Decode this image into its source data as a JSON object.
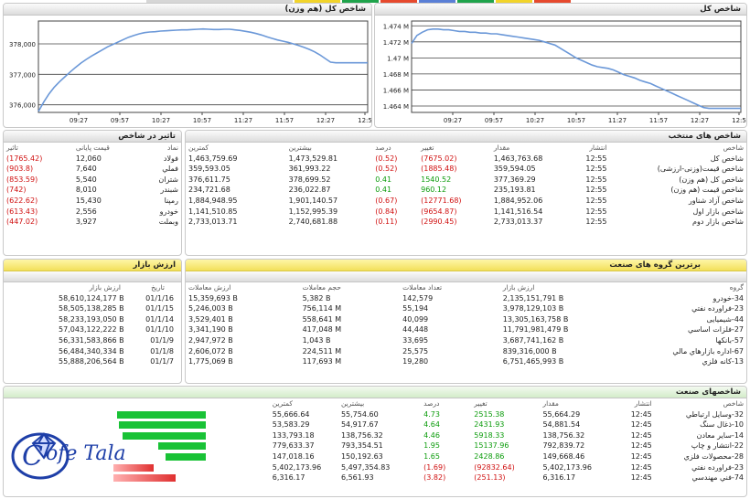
{
  "top_strip_colors": [
    "#d6d6d6",
    "#f2d42a",
    "#1fa34b",
    "#e6492d",
    "#5a7fd6",
    "#1fa34b",
    "#f2d42a",
    "#e6492d"
  ],
  "chart_left": {
    "title": "شاخص کل (هم وزن)",
    "chart_data": {
      "type": "line",
      "title": "شاخص کل (هم وزن)",
      "x_ticks": [
        "09:27",
        "09:57",
        "10:27",
        "10:57",
        "11:27",
        "11:57",
        "12:27",
        "12:5"
      ],
      "y_ticks": [
        "376,000",
        "377,000",
        "378,000"
      ],
      "ylim": [
        375750,
        378750
      ],
      "x": [
        0,
        3,
        6,
        9,
        12,
        15,
        18,
        21,
        24,
        27,
        30,
        33,
        36,
        39,
        42,
        45,
        48,
        51,
        54,
        57,
        60,
        63,
        66,
        69,
        72,
        75,
        78,
        81,
        84,
        87,
        90,
        93,
        96,
        99,
        102,
        105,
        108,
        111,
        114,
        117,
        120,
        123,
        126,
        129,
        132,
        135,
        138,
        141,
        144,
        147,
        150,
        153,
        156,
        159,
        162,
        165,
        168,
        171,
        174,
        177,
        180,
        183,
        186
      ],
      "y": [
        375780,
        376090,
        376360,
        376580,
        376760,
        376920,
        377080,
        377230,
        377370,
        377490,
        377600,
        377700,
        377800,
        377900,
        377980,
        378060,
        378140,
        378220,
        378280,
        378330,
        378370,
        378390,
        378400,
        378420,
        378430,
        378440,
        378450,
        378460,
        378460,
        378470,
        378480,
        378490,
        378480,
        378470,
        378470,
        378480,
        378480,
        378460,
        378440,
        378410,
        378380,
        378340,
        378290,
        378230,
        378180,
        378130,
        378090,
        378050,
        378000,
        377950,
        377890,
        377820,
        377740,
        377640,
        377520,
        377400,
        377380,
        377380,
        377380,
        377380,
        377380,
        377380,
        377380
      ]
    }
  },
  "chart_right": {
    "title": "شاخص کل",
    "chart_data": {
      "type": "line",
      "title": "شاخص کل",
      "x_ticks": [
        "09:27",
        "09:57",
        "10:27",
        "10:57",
        "11:27",
        "11:57",
        "12:27",
        "12:5"
      ],
      "y_ticks": [
        "1.464 M",
        "1.466 M",
        "1.468 M",
        "1.47 M",
        "1.472 M",
        "1.474 M"
      ],
      "ylim": [
        1.4632,
        1.4746
      ],
      "x": [
        0,
        3,
        6,
        9,
        12,
        15,
        18,
        21,
        24,
        27,
        30,
        33,
        36,
        39,
        42,
        45,
        48,
        51,
        54,
        57,
        60,
        63,
        66,
        69,
        72,
        75,
        78,
        81,
        84,
        87,
        90,
        93,
        96,
        99,
        102,
        105,
        108,
        111,
        114,
        117,
        120,
        123,
        126,
        129,
        132,
        135,
        138,
        141,
        144,
        147,
        150,
        153,
        156,
        159,
        162,
        165,
        168,
        171,
        174,
        177,
        180,
        183,
        186
      ],
      "y": [
        1.4718,
        1.4728,
        1.4732,
        1.4735,
        1.4736,
        1.4736,
        1.4735,
        1.4735,
        1.4734,
        1.4733,
        1.4733,
        1.4732,
        1.4732,
        1.4731,
        1.4731,
        1.473,
        1.473,
        1.4729,
        1.4728,
        1.4727,
        1.4726,
        1.4725,
        1.4724,
        1.4723,
        1.4722,
        1.472,
        1.4718,
        1.4716,
        1.4712,
        1.4708,
        1.4704,
        1.47,
        1.4697,
        1.4694,
        1.4691,
        1.4689,
        1.4688,
        1.4687,
        1.4685,
        1.4682,
        1.4679,
        1.4677,
        1.4675,
        1.4672,
        1.467,
        1.4668,
        1.4665,
        1.4662,
        1.4659,
        1.4656,
        1.4653,
        1.465,
        1.4647,
        1.4644,
        1.4641,
        1.4638,
        1.4637,
        1.4637,
        1.4637,
        1.4637,
        1.4637,
        1.4637,
        1.4637
      ]
    }
  },
  "influence": {
    "title": "تاثیر در شاخص",
    "headers": [
      "نماد",
      "قیمت پایانی",
      "تاثیر"
    ],
    "rows": [
      [
        "فولاد",
        "12,060",
        "(1765.42)"
      ],
      [
        "فملي",
        "7,640",
        "(903.8)"
      ],
      [
        "شتران",
        "5,540",
        "(853.59)"
      ],
      [
        "شبندر",
        "8,010",
        "(742)"
      ],
      [
        "رمپنا",
        "15,430",
        "(622.62)"
      ],
      [
        "خودرو",
        "2,556",
        "(613.43)"
      ],
      [
        "وبملت",
        "3,927",
        "(447.02)"
      ]
    ]
  },
  "indices": {
    "title": "شاخص های منتخب",
    "headers": [
      "شاخص",
      "انتشار",
      "مقدار",
      "تغییر",
      "درصد",
      "بیشترین",
      "کمترین"
    ],
    "rows": [
      {
        "c": [
          "شاخص کل",
          "12:55",
          "1,463,763.68",
          "(7675.02)",
          "(0.52)",
          "1,473,529.81",
          "1,463,759.69"
        ],
        "s": "neg"
      },
      {
        "c": [
          "شاخص قیمت(وزنی-ارزشی)",
          "12:55",
          "359,594.05",
          "(1885.48)",
          "(0.52)",
          "361,993.22",
          "359,593.05"
        ],
        "s": "neg"
      },
      {
        "c": [
          "شاخص کل (هم وزن)",
          "12:55",
          "377,369.29",
          "1540.52",
          "0.41",
          "378,699.52",
          "376,611.75"
        ],
        "s": "pos"
      },
      {
        "c": [
          "شاخص قیمت (هم وزن)",
          "12:55",
          "235,193.81",
          "960.12",
          "0.41",
          "236,022.87",
          "234,721.68"
        ],
        "s": "pos"
      },
      {
        "c": [
          "شاخص آزاد شناور",
          "12:55",
          "1,884,952.06",
          "(12771.68)",
          "(0.67)",
          "1,901,140.57",
          "1,884,948.95"
        ],
        "s": "neg"
      },
      {
        "c": [
          "شاخص بازار اول",
          "12:55",
          "1,141,516.54",
          "(9654.87)",
          "(0.84)",
          "1,152,995.39",
          "1,141,510.85"
        ],
        "s": "neg"
      },
      {
        "c": [
          "شاخص بازار دوم",
          "12:55",
          "2,733,013.37",
          "(2990.45)",
          "(0.11)",
          "2,740,681.88",
          "2,733,013.71"
        ],
        "s": "neg"
      }
    ]
  },
  "market_value": {
    "title": "ارزش بازار",
    "headers": [
      "تاریخ",
      "ارزش بازار"
    ],
    "rows": [
      [
        "01/1/16",
        "58,610,124,177 B"
      ],
      [
        "01/1/15",
        "58,505,138,285 B"
      ],
      [
        "01/1/14",
        "58,233,193,050 B"
      ],
      [
        "01/1/10",
        "57,043,122,222 B"
      ],
      [
        "01/1/9",
        "56,331,583,866 B"
      ],
      [
        "01/1/8",
        "56,484,340,334 B"
      ],
      [
        "01/1/7",
        "55,888,206,564 B"
      ]
    ]
  },
  "top_groups": {
    "title": "برترین گروه های صنعت",
    "headers": [
      "گروه",
      "ارزش بازار",
      "تعداد معاملات",
      "حجم معاملات",
      "ارزش معاملات"
    ],
    "rows": [
      [
        "34-خودرو",
        "2,135,151,791 B",
        "142,579",
        "5,382 B",
        "15,359,693 B"
      ],
      [
        "23-فراورده نفتي",
        "3,978,129,103 B",
        "55,194",
        "756,114 M",
        "5,246,003 B"
      ],
      [
        "44-شیمیایی",
        "13,305,163,758 B",
        "40,099",
        "558,641 M",
        "3,529,401 B"
      ],
      [
        "27-فلزات اساسي",
        "11,791,981,479 B",
        "44,448",
        "417,048 M",
        "3,341,190 B"
      ],
      [
        "57-بانکها",
        "3,687,741,162 B",
        "33,695",
        "1,043 B",
        "2,947,972 B"
      ],
      [
        "67-اداره بازارهاي مالي",
        "839,316,000 B",
        "25,575",
        "224,511 M",
        "2,606,072 B"
      ],
      [
        "13-کانه فلزي",
        "6,751,465,993 B",
        "19,280",
        "117,693 M",
        "1,775,069 B"
      ]
    ]
  },
  "industry": {
    "title": "شاخصهای صنعت",
    "headers": [
      "شاخص",
      "انتشار",
      "مقدار",
      "تغییر",
      "درصد",
      "بیشترین",
      "کمترین"
    ],
    "rows": [
      {
        "c": [
          "32-وسایل ارتباطي",
          "12:45",
          "55,664.29",
          "2515.38",
          "4.73",
          "55,754.60",
          "55,666.64"
        ],
        "s": "pos",
        "bar": "pos",
        "mag": 0.97
      },
      {
        "c": [
          "10-ذغال سنگ",
          "12:45",
          "54,881.54",
          "2431.93",
          "4.64",
          "54,917.67",
          "53,583.29"
        ],
        "s": "pos",
        "bar": "pos",
        "mag": 0.95
      },
      {
        "c": [
          "14-سایر معادن",
          "12:45",
          "138,756.32",
          "5918.33",
          "4.46",
          "138,756.32",
          "133,793.18"
        ],
        "s": "pos",
        "bar": "pos",
        "mag": 0.91
      },
      {
        "c": [
          "22-انتشار و چاپ",
          "12:45",
          "792,839.72",
          "15137.96",
          "1.95",
          "793,354.51",
          "779,633.37"
        ],
        "s": "pos",
        "bar": "pos",
        "mag": 0.52
      },
      {
        "c": [
          "28-محصولات فلزي",
          "12:45",
          "149,668.46",
          "2428.86",
          "1.65",
          "150,192.63",
          "147,018.16"
        ],
        "s": "pos",
        "bar": "pos",
        "mag": 0.44
      },
      {
        "c": [
          "23-فراورده نفتي",
          "12:45",
          "5,402,173.96",
          "(92832.64)",
          "(1.69)",
          "5,497,354.83",
          "5,402,173.96"
        ],
        "s": "neg",
        "bar": "neg",
        "mag": 0.44
      },
      {
        "c": [
          "74-فني مهندسي",
          "12:45",
          "6,316.17",
          "(251.13)",
          "(3.82)",
          "6,561.93",
          "6,316.17"
        ],
        "s": "neg",
        "bar": "neg",
        "mag": 0.68
      }
    ]
  },
  "logo": {
    "text": "Cofe Tala",
    "color": "#1e3fa8"
  }
}
